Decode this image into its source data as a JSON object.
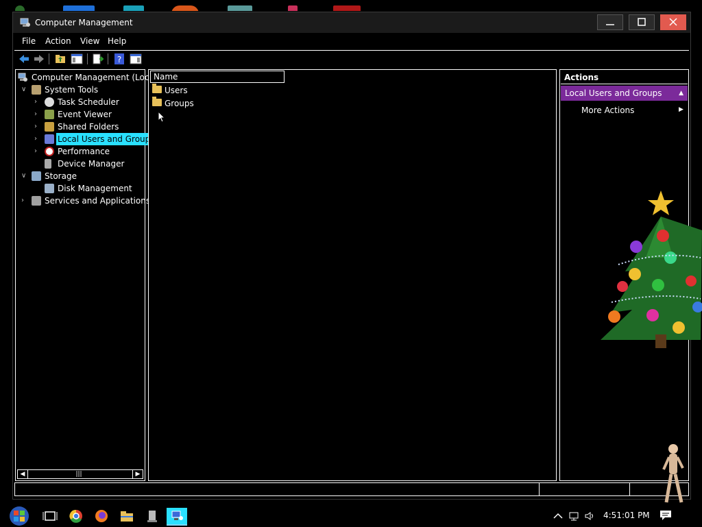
{
  "window": {
    "title": "Computer Management"
  },
  "menubar": {
    "items": [
      "File",
      "Action",
      "View",
      "Help"
    ]
  },
  "toolbar": {
    "icons": [
      "back-icon",
      "forward-icon",
      "up-folder-icon",
      "show-hide-tree-icon",
      "export-list-icon",
      "help-icon",
      "show-hide-action-pane-icon"
    ]
  },
  "tree": {
    "root": "Computer Management (Local)",
    "items": [
      {
        "label": "System Tools",
        "level": 1,
        "expanded": true,
        "icon": "tools-icon"
      },
      {
        "label": "Task Scheduler",
        "level": 2,
        "expanded": false,
        "icon": "clock-icon"
      },
      {
        "label": "Event Viewer",
        "level": 2,
        "expanded": false,
        "icon": "event-viewer-icon"
      },
      {
        "label": "Shared Folders",
        "level": 2,
        "expanded": false,
        "icon": "shared-folder-icon"
      },
      {
        "label": "Local Users and Groups",
        "level": 2,
        "expanded": false,
        "icon": "users-icon",
        "selected": true
      },
      {
        "label": "Performance",
        "level": 2,
        "expanded": false,
        "icon": "performance-icon"
      },
      {
        "label": "Device Manager",
        "level": 2,
        "expanded": null,
        "icon": "device-manager-icon"
      },
      {
        "label": "Storage",
        "level": 1,
        "expanded": true,
        "icon": "storage-icon"
      },
      {
        "label": "Disk Management",
        "level": 2,
        "expanded": null,
        "icon": "disk-icon"
      },
      {
        "label": "Services and Applications",
        "level": 1,
        "expanded": false,
        "icon": "services-icon"
      }
    ]
  },
  "list": {
    "column": "Name",
    "items": [
      "Users",
      "Groups"
    ]
  },
  "actions": {
    "header": "Actions",
    "section": "Local Users and Groups",
    "more": "More Actions"
  },
  "taskbar": {
    "time": "4:51:01 PM",
    "apps": [
      "start-orb-icon",
      "task-view-icon",
      "chrome-icon",
      "firefox-icon",
      "file-explorer-icon",
      "device-icon",
      "computer-management-icon"
    ]
  },
  "colors": {
    "selection": "#2ae0ff",
    "actions_section": "#7b2a9a",
    "close_button": "#e25a4f"
  }
}
